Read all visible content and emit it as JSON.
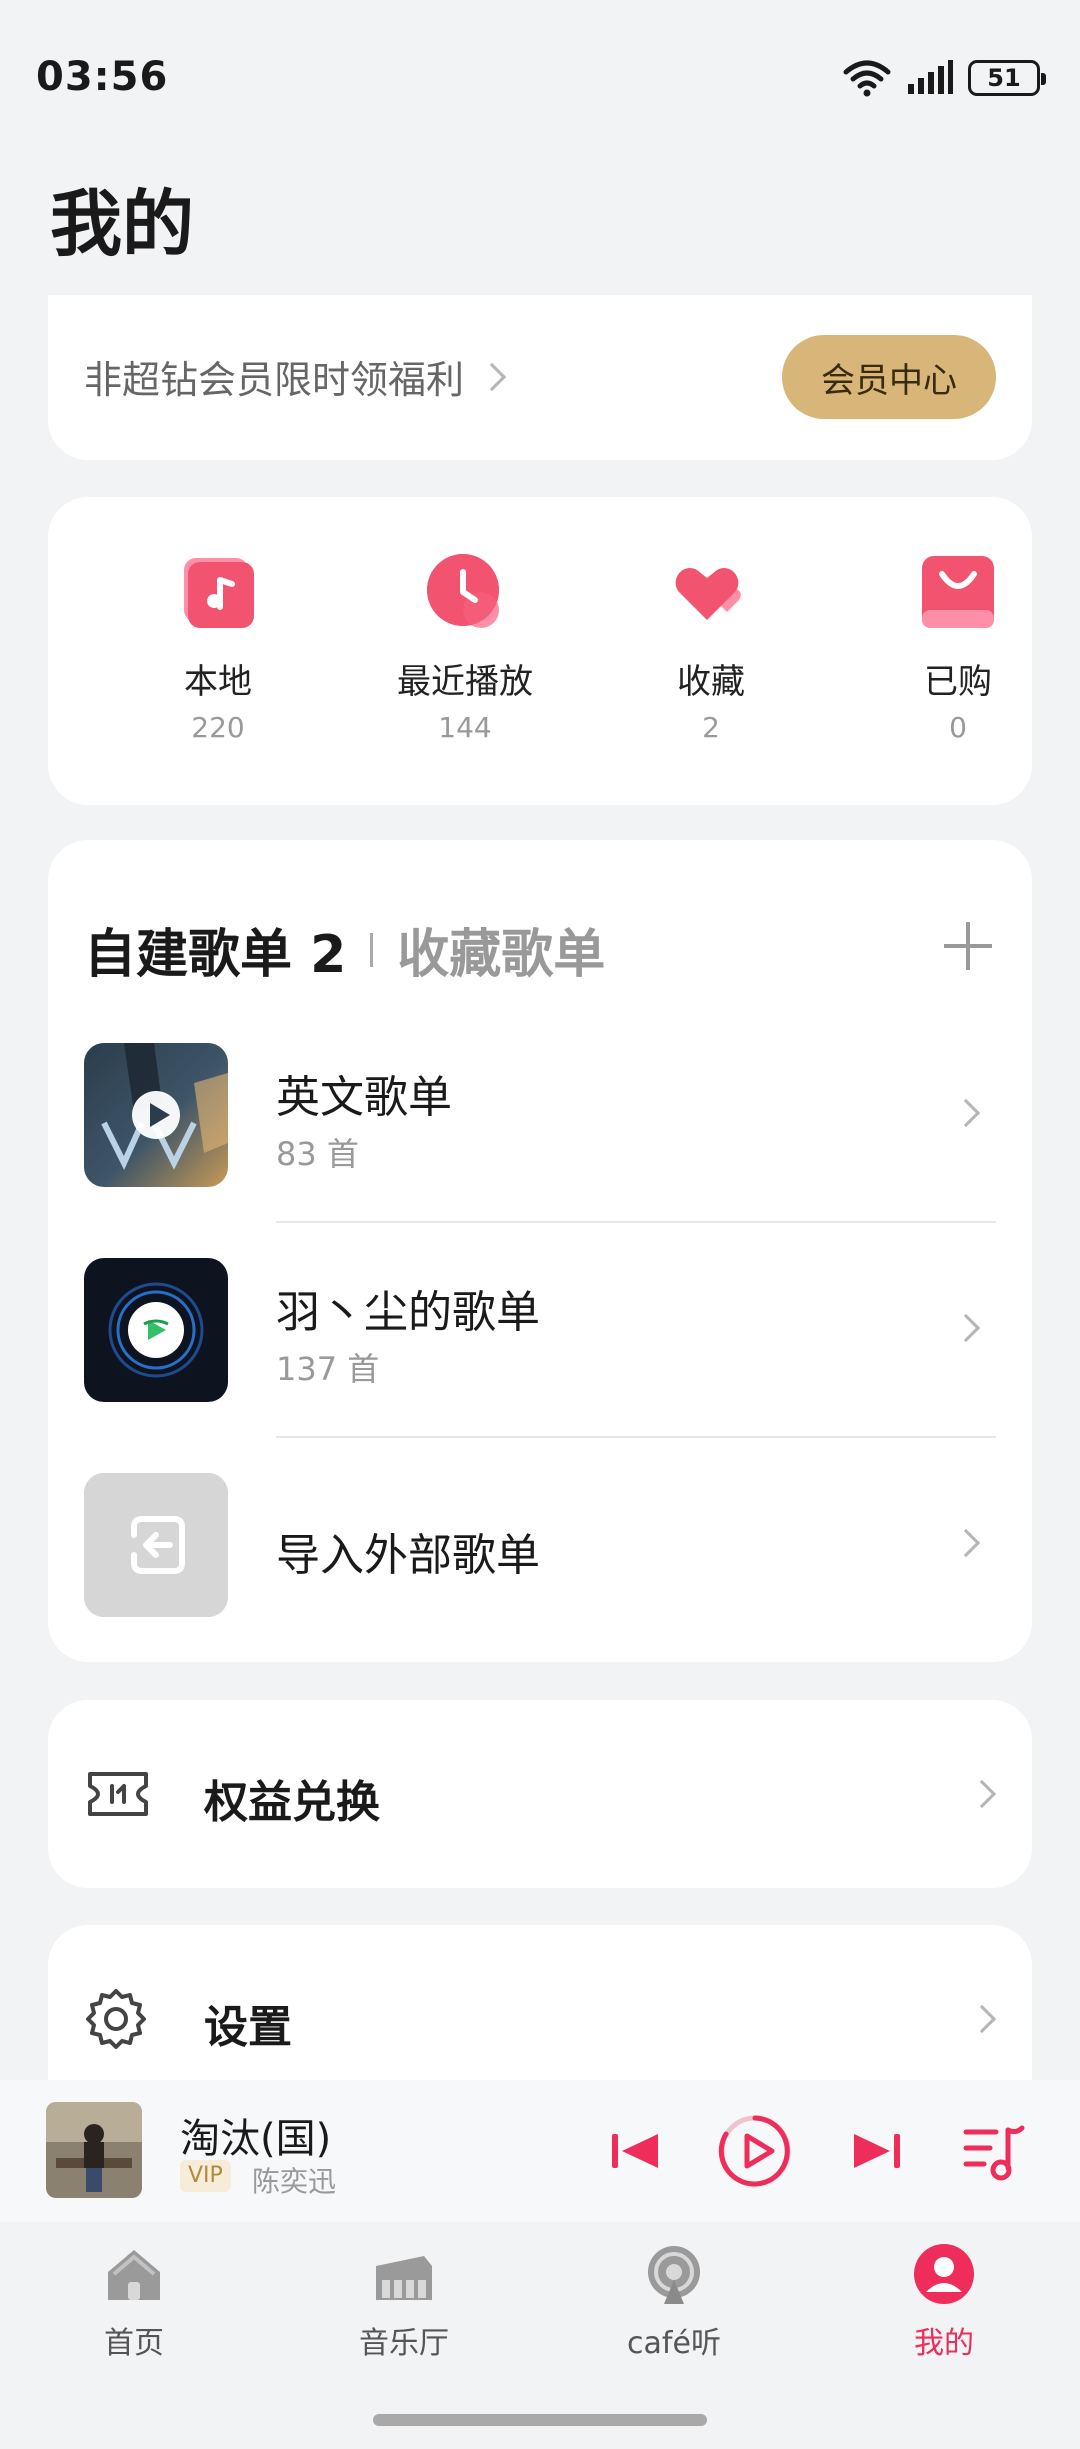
{
  "status_bar": {
    "time": "03:56",
    "battery": "51"
  },
  "page_title": "我的",
  "vip_banner": {
    "text": "非超钻会员限时领福利",
    "button": "会员中心"
  },
  "shortcuts": [
    {
      "label": "本地",
      "count": "220",
      "icon": "music-note-icon"
    },
    {
      "label": "最近播放",
      "count": "144",
      "icon": "clock-icon"
    },
    {
      "label": "收藏",
      "count": "2",
      "icon": "heart-icon"
    },
    {
      "label": "已购",
      "count": "0",
      "icon": "shopping-bag-icon"
    }
  ],
  "playlists": {
    "tab_active": "自建歌单 2",
    "tab_other": "收藏歌单",
    "items": [
      {
        "name": "英文歌单",
        "count": "83 首"
      },
      {
        "name": "羽丶尘的歌单",
        "count": "137 首"
      },
      {
        "name": "导入外部歌单"
      }
    ]
  },
  "rows": {
    "redeem": "权益兑换",
    "settings": "设置"
  },
  "now_playing": {
    "title": "淘汰(国)",
    "badge": "VIP",
    "artist": "陈奕迅"
  },
  "nav": [
    {
      "label": "首页",
      "icon": "home-icon"
    },
    {
      "label": "音乐厅",
      "icon": "piano-icon"
    },
    {
      "label": "café听",
      "icon": "podcast-icon"
    },
    {
      "label": "我的",
      "icon": "profile-icon",
      "active": true
    }
  ],
  "colors": {
    "accent": "#ee2d5a",
    "vip_gold": "#d8b67a",
    "background": "#f2f3f5"
  }
}
